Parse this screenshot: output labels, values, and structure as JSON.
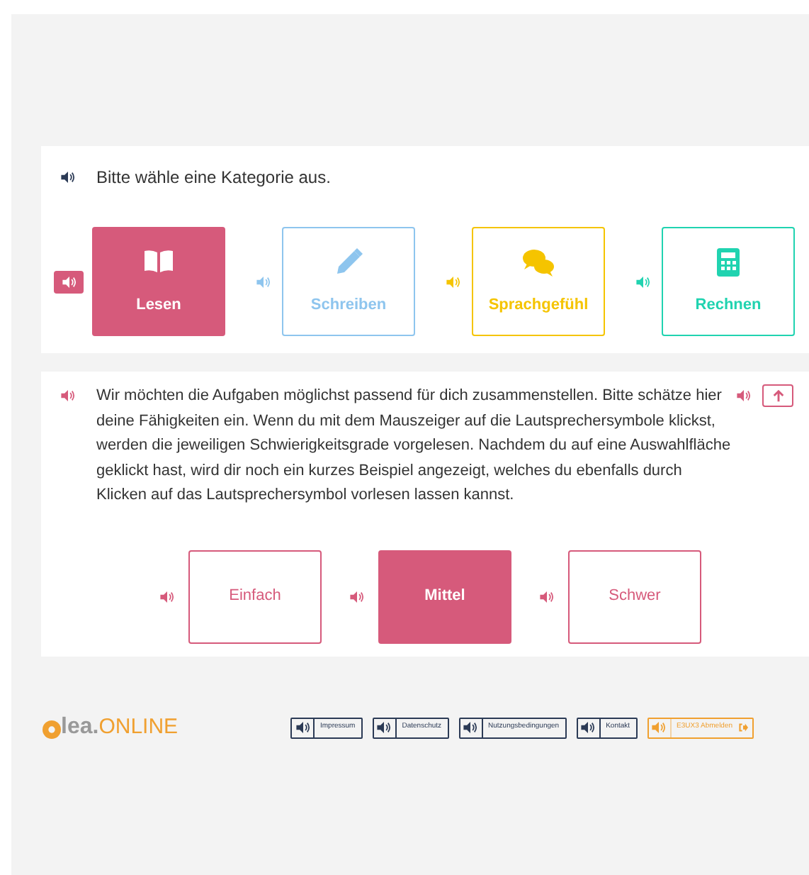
{
  "category_panel": {
    "prompt": "Bitte wähle eine Kategorie aus.",
    "categories": [
      {
        "label": "Lesen",
        "kind": "book",
        "color": "#d65a7b",
        "selected": true
      },
      {
        "label": "Schreiben",
        "kind": "pencil",
        "color": "#8ec5ee",
        "selected": false
      },
      {
        "label": "Sprachgefühl",
        "kind": "chat",
        "color": "#f5c400",
        "selected": false
      },
      {
        "label": "Rechnen",
        "kind": "calculator",
        "color": "#20d3b0",
        "selected": false
      }
    ]
  },
  "level_panel": {
    "intro": "Wir möchten die Aufgaben möglichst passend für dich zusammenstellen. Bitte schätze hier deine Fähigkeiten ein. Wenn du mit dem Mauszeiger auf die Lautsprechersymbole klickst, werden die jeweiligen Schwierigkeitsgrade vorgelesen. Nachdem du auf eine Auswahlfläche geklickt hast, wird dir noch ein kurzes Beispiel angezeigt, welches du ebenfalls durch Klicken auf das Lautsprechersymbol vorlesen lassen kannst.",
    "levels": [
      {
        "label": "Einfach",
        "selected": false
      },
      {
        "label": "Mittel",
        "selected": true
      },
      {
        "label": "Schwer",
        "selected": false
      }
    ]
  },
  "footer": {
    "logo": {
      "name": "lea.",
      "suffix": "ONLINE"
    },
    "links": [
      {
        "label": "Impressum",
        "kind": "link"
      },
      {
        "label": "Datenschutz",
        "kind": "link"
      },
      {
        "label": "Nutzungsbedingungen",
        "kind": "link"
      },
      {
        "label": "Kontakt",
        "kind": "link"
      },
      {
        "label": "E3UX3 Abmelden",
        "kind": "logout"
      }
    ]
  }
}
